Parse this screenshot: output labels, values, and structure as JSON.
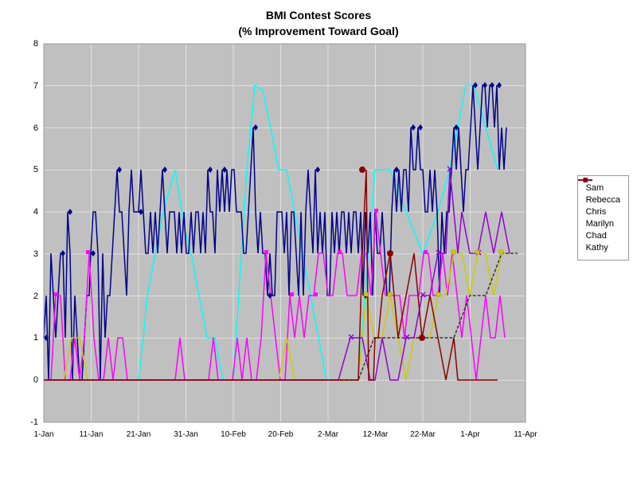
{
  "chart": {
    "title_line1": "BMI Contest Scores",
    "title_line2": "(% Improvement Toward Goal)",
    "y_axis": {
      "min": -1,
      "max": 8,
      "labels": [
        "8",
        "7",
        "6",
        "5",
        "4",
        "3",
        "2",
        "1",
        "0",
        "-1"
      ]
    },
    "x_axis": {
      "labels": [
        "1-Jan",
        "11-Jan",
        "21-Jan",
        "31-Jan",
        "10-Feb",
        "20-Feb",
        "2-Mar",
        "12-Mar",
        "22-Mar",
        "1-Apr",
        "11-Apr"
      ]
    },
    "legend": {
      "items": [
        {
          "name": "Sam",
          "color": "#00008B",
          "marker": "diamond"
        },
        {
          "name": "Rebecca",
          "color": "#FF00FF",
          "marker": "square"
        },
        {
          "name": "Chris",
          "color": "#CCCC00",
          "marker": "square"
        },
        {
          "name": "Marilyn",
          "color": "#333333",
          "marker": "none"
        },
        {
          "name": "Chad",
          "color": "#800080",
          "marker": "x"
        },
        {
          "name": "Kathy",
          "color": "#8B0000",
          "marker": "circle"
        }
      ]
    }
  }
}
